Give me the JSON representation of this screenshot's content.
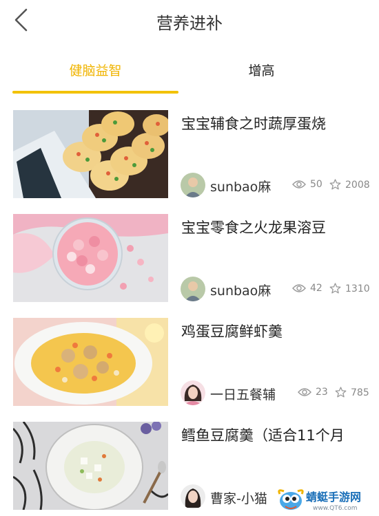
{
  "header": {
    "title": "营养进补"
  },
  "tabs": [
    {
      "label": "健脑益智",
      "active": true
    },
    {
      "label": "增高",
      "active": false
    }
  ],
  "articles": [
    {
      "title": "宝宝辅食之时蔬厚蛋烧",
      "author": "sunbao麻",
      "views": "50",
      "favorites": "2008"
    },
    {
      "title": "宝宝零食之火龙果溶豆",
      "author": "sunbao麻",
      "views": "42",
      "favorites": "1310"
    },
    {
      "title": "鸡蛋豆腐鲜虾羹",
      "author": "一日五餐辅",
      "views": "23",
      "favorites": "785"
    },
    {
      "title": "鳕鱼豆腐羹（适合11个月",
      "author": "曹家-小猫"
    }
  ],
  "watermark": {
    "name": "蜻蜓手游网",
    "url": "www.QT6.com"
  },
  "colors": {
    "accent": "#f0b400",
    "underline": "#f2c200",
    "meta_gray": "#888888"
  }
}
